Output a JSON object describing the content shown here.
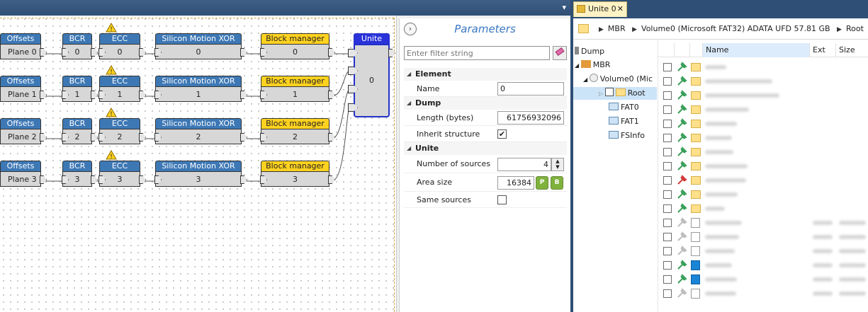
{
  "graph": {
    "rows": [
      {
        "offsets": "Offsets",
        "plane": "Plane 0",
        "bcr_head": "BCR",
        "bcr_val": "0",
        "ecc_head": "ECC",
        "ecc_val": "0",
        "smx_head": "Silicon Motion XOR",
        "smx_val": "0",
        "bm_head": "Block manager",
        "bm_val": "0"
      },
      {
        "offsets": "Offsets",
        "plane": "Plane 1",
        "bcr_head": "BCR",
        "bcr_val": "1",
        "ecc_head": "ECC",
        "ecc_val": "1",
        "smx_head": "Silicon Motion XOR",
        "smx_val": "1",
        "bm_head": "Block manager",
        "bm_val": "1"
      },
      {
        "offsets": "Offsets",
        "plane": "Plane 2",
        "bcr_head": "BCR",
        "bcr_val": "2",
        "ecc_head": "ECC",
        "ecc_val": "2",
        "smx_head": "Silicon Motion XOR",
        "smx_val": "2",
        "bm_head": "Block manager",
        "bm_val": "2"
      },
      {
        "offsets": "Offsets",
        "plane": "Plane 3",
        "bcr_head": "BCR",
        "bcr_val": "3",
        "ecc_head": "ECC",
        "ecc_val": "3",
        "smx_head": "Silicon Motion XOR",
        "smx_val": "3",
        "bm_head": "Block manager",
        "bm_val": "3"
      }
    ],
    "unite": {
      "head": "Unite",
      "value": "0"
    },
    "colors": {
      "blue_head": "#3d78b5",
      "yellow_head": "#ffd21f",
      "unite_head": "#2a33d9",
      "node_body": "#d7d7d7"
    }
  },
  "params": {
    "title": "Parameters",
    "filter_placeholder": "Enter filter string",
    "cat_element": "Element",
    "name_label": "Name",
    "name_value": "0",
    "cat_dump": "Dump",
    "length_label": "Length (bytes)",
    "length_value": "61756932096",
    "inherit_label": "Inherit structure",
    "inherit_checked": "✔",
    "cat_unite": "Unite",
    "sources_label": "Number of sources",
    "sources_value": "4",
    "area_label": "Area size",
    "area_value": "16384",
    "same_label": "Same sources"
  },
  "rightpane": {
    "tab_label": "Unite 0",
    "tab_close": "✕",
    "crumbs": [
      "MBR",
      "Volume0 (Microsoft FAT32) ADATA UFD  57.81 GB",
      "Root"
    ],
    "tree": {
      "dump": "Dump",
      "mbr": "MBR",
      "volume": "Volume0 (Mic",
      "root": "Root",
      "fat0": "FAT0",
      "fat1": "FAT1",
      "fsinfo": "FSInfo"
    },
    "columns": {
      "name": "Name",
      "ext": "Ext",
      "size": "Size"
    }
  }
}
